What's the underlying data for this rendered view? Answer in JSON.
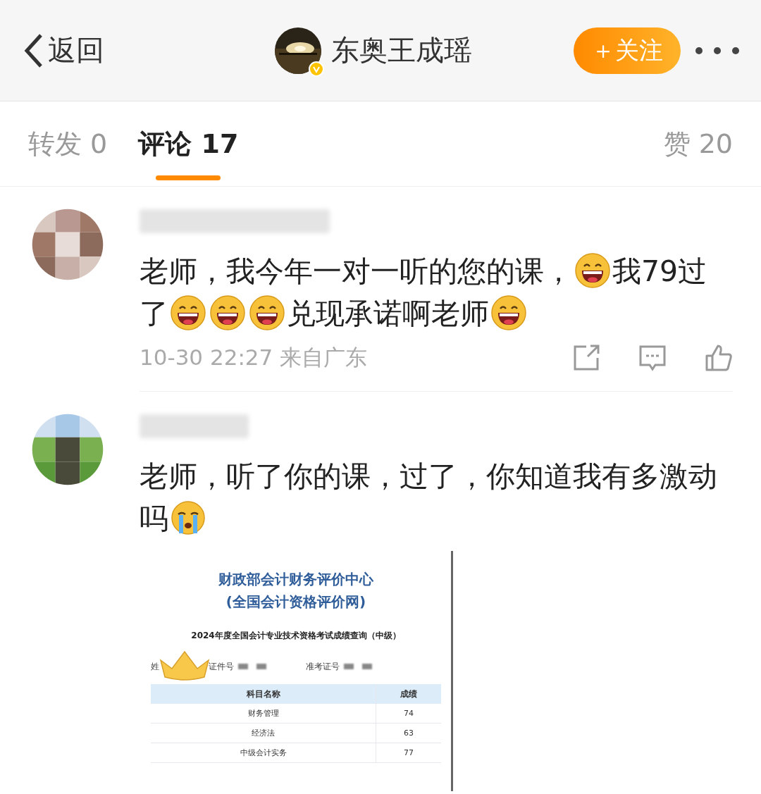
{
  "header": {
    "back": "返回",
    "account_name": "东奥王成瑶",
    "verified": true,
    "follow_button": "＋关注"
  },
  "tabs": [
    {
      "label": "转发 0",
      "selected": false
    },
    {
      "label": "评论 17",
      "selected": true
    },
    {
      "label": "赞 20",
      "selected": false
    }
  ],
  "comments": [
    {
      "segments": [
        {
          "kind": "text",
          "text": "老师，我今年一对一听的您的课，"
        },
        {
          "kind": "laugh-emoji"
        },
        {
          "kind": "text",
          "text": "我79过"
        },
        {
          "kind": "text",
          "text": "了"
        },
        {
          "kind": "laugh-emoji"
        },
        {
          "kind": "laugh-emoji"
        },
        {
          "kind": "laugh-emoji"
        },
        {
          "kind": "text",
          "text": "兑现承诺啊老师"
        },
        {
          "kind": "laugh-emoji"
        }
      ],
      "meta": "10-30 22:27 来自广东"
    },
    {
      "segments": [
        {
          "kind": "text",
          "text": "老师，听了你的课，过了，你知道我有多激动"
        },
        {
          "kind": "text",
          "text": "吗"
        },
        {
          "kind": "cry-emoji"
        }
      ],
      "attachment": {
        "title": "财政部会计财务评价中心",
        "subtitle": "(全国会计资格评价网)",
        "heading": "2024年度全国会计专业技术资格考试成绩查询（中级）",
        "fields": [
          {
            "label": "姓"
          },
          {
            "label": "证件号"
          },
          {
            "label": "准考证号"
          }
        ],
        "columns": [
          "科目名称",
          "成绩"
        ],
        "rows": [
          [
            "财务管理",
            "74"
          ],
          [
            "经济法",
            "63"
          ],
          [
            "中级会计实务",
            "77"
          ]
        ]
      }
    }
  ]
}
